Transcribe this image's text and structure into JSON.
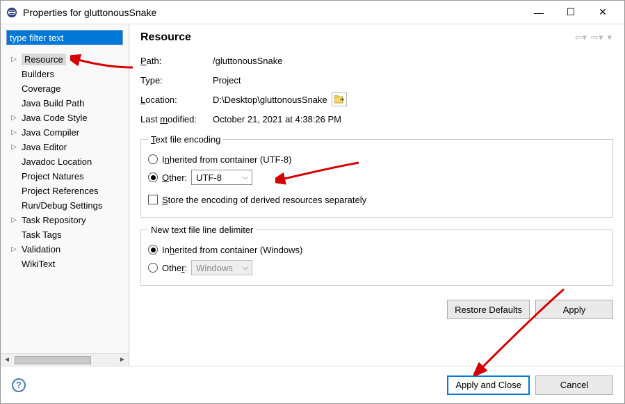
{
  "window": {
    "title": "Properties for gluttonousSnake"
  },
  "filter": {
    "value": "type filter text"
  },
  "tree": {
    "items": [
      {
        "label": "Resource",
        "expandable": true,
        "selected": true
      },
      {
        "label": "Builders",
        "expandable": false
      },
      {
        "label": "Coverage",
        "expandable": false
      },
      {
        "label": "Java Build Path",
        "expandable": false
      },
      {
        "label": "Java Code Style",
        "expandable": true
      },
      {
        "label": "Java Compiler",
        "expandable": true
      },
      {
        "label": "Java Editor",
        "expandable": true
      },
      {
        "label": "Javadoc Location",
        "expandable": false
      },
      {
        "label": "Project Natures",
        "expandable": false
      },
      {
        "label": "Project References",
        "expandable": false
      },
      {
        "label": "Run/Debug Settings",
        "expandable": false
      },
      {
        "label": "Task Repository",
        "expandable": true
      },
      {
        "label": "Task Tags",
        "expandable": false
      },
      {
        "label": "Validation",
        "expandable": true
      },
      {
        "label": "WikiText",
        "expandable": false
      }
    ]
  },
  "page": {
    "heading": "Resource",
    "path_label": "Path:",
    "path_value": "/gluttonousSnake",
    "type_label": "Type:",
    "type_value": "Project",
    "location_label": "Location:",
    "location_value": "D:\\Desktop\\gluttonousSnake",
    "modified_label": "Last modified:",
    "modified_value": "October 21, 2021 at 4:38:26 PM",
    "encoding": {
      "legend": "Text file encoding",
      "inherited_label": "Inherited from container (UTF-8)",
      "other_label": "Other:",
      "other_value": "UTF-8",
      "store_label": "Store the encoding of derived resources separately",
      "selected": "other",
      "store_checked": false
    },
    "delimiter": {
      "legend": "New text file line delimiter",
      "inherited_label": "Inherited from container (Windows)",
      "other_label": "Other:",
      "other_value": "Windows",
      "selected": "inherited"
    },
    "buttons": {
      "restore": "Restore Defaults",
      "apply": "Apply",
      "apply_close": "Apply and Close",
      "cancel": "Cancel"
    }
  }
}
